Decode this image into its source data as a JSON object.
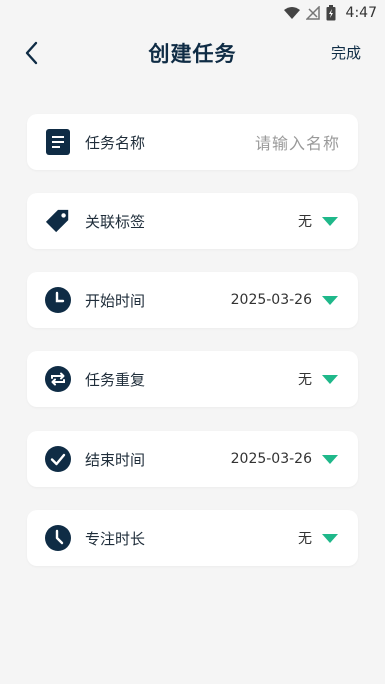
{
  "status_bar": {
    "time": "4:47",
    "icons": [
      "wifi-icon",
      "signal-icon",
      "battery-icon"
    ]
  },
  "header": {
    "title": "创建任务",
    "done_label": "完成"
  },
  "fields": {
    "name": {
      "label": "任务名称",
      "placeholder": "请输入名称"
    },
    "tags": {
      "label": "关联标签",
      "value": "无"
    },
    "start": {
      "label": "开始时间",
      "value": "2025-03-26"
    },
    "repeat": {
      "label": "任务重复",
      "value": "无"
    },
    "end": {
      "label": "结束时间",
      "value": "2025-03-26"
    },
    "focus": {
      "label": "专注时长",
      "value": "无"
    }
  },
  "colors": {
    "primary": "#0f2c45",
    "accent": "#1fb88a",
    "background": "#f5f5f5"
  }
}
